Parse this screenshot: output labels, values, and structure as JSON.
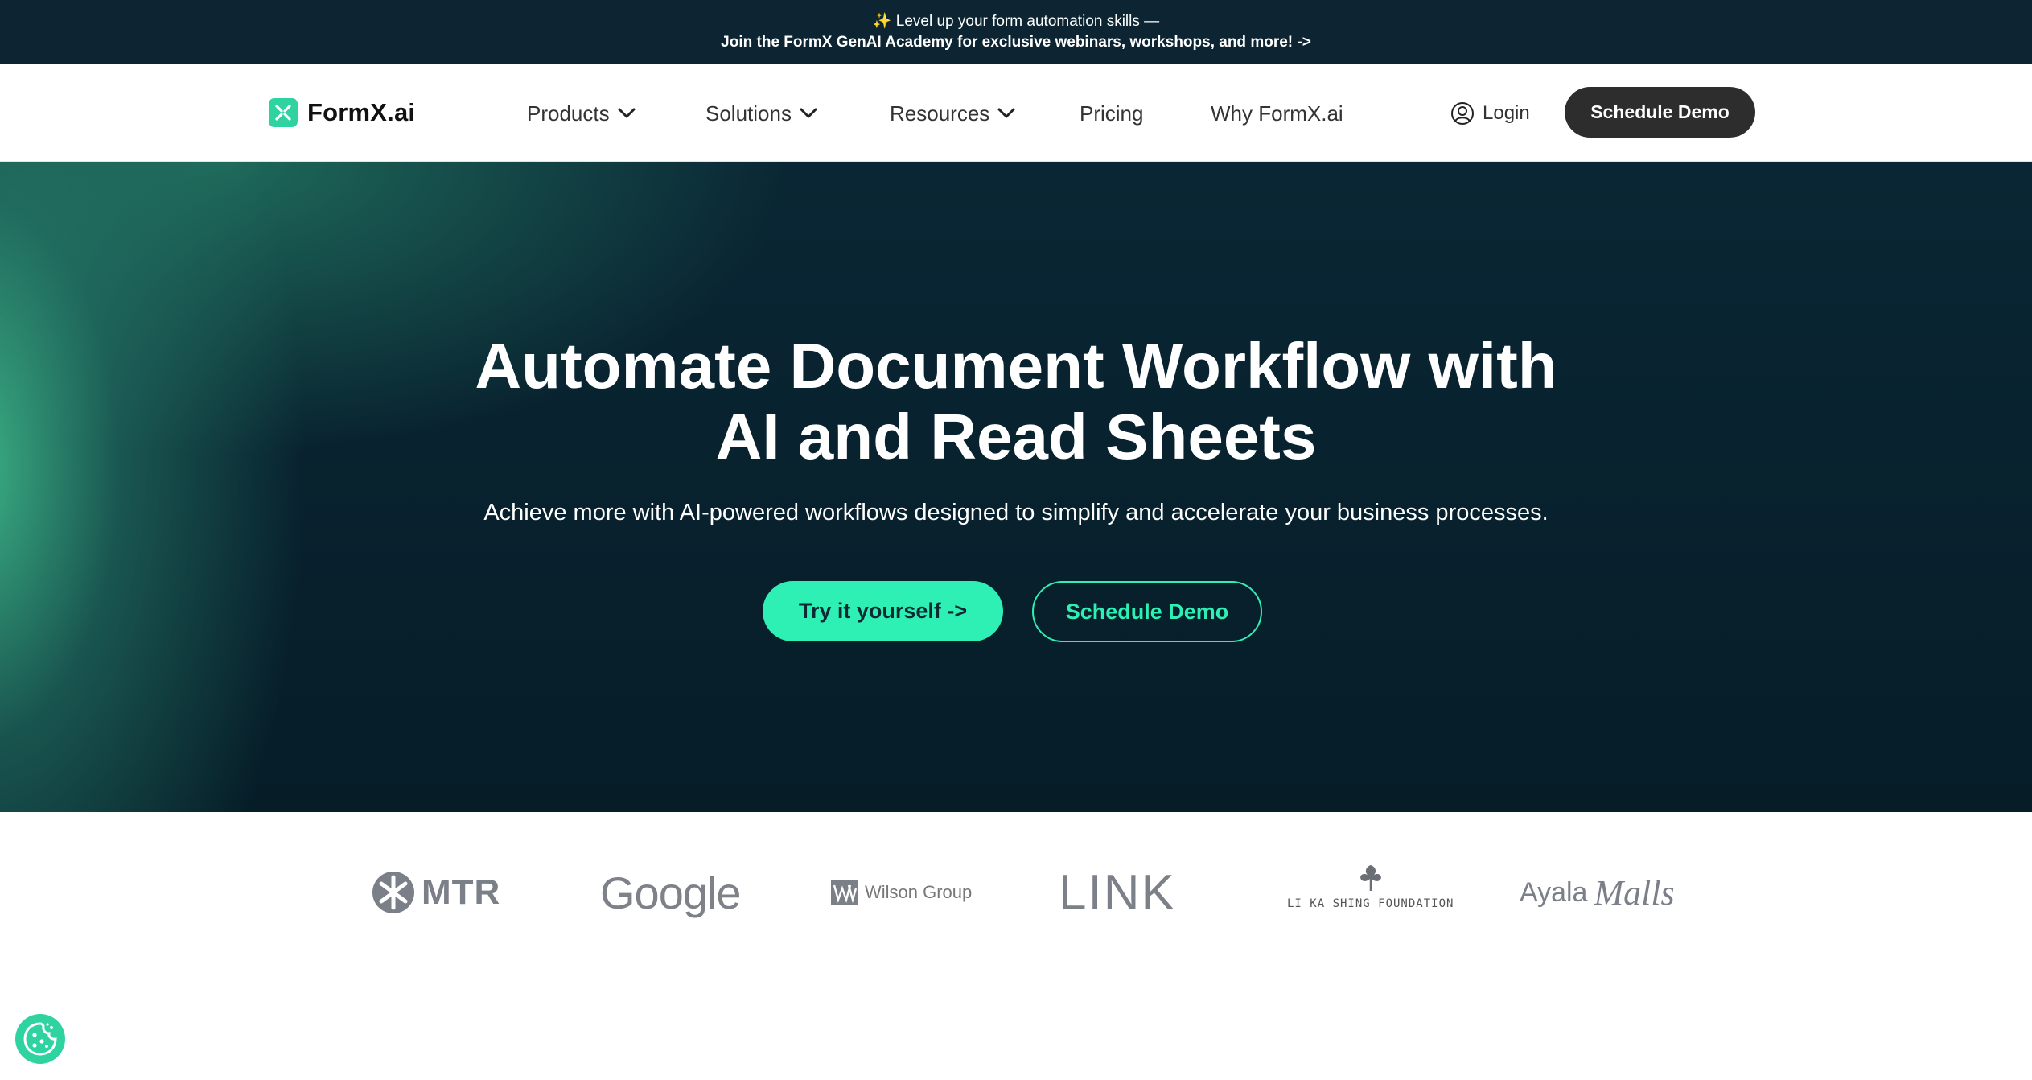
{
  "announcement": {
    "line1": "✨ Level up your form automation skills —",
    "line2": "Join the FormX GenAI Academy for exclusive webinars, workshops, and more! ->"
  },
  "nav": {
    "logo_text": "FormX.ai",
    "items": [
      {
        "label": "Products",
        "has_dropdown": true
      },
      {
        "label": "Solutions",
        "has_dropdown": true
      },
      {
        "label": "Resources",
        "has_dropdown": true
      },
      {
        "label": "Pricing",
        "has_dropdown": false
      },
      {
        "label": "Why FormX.ai",
        "has_dropdown": false
      }
    ],
    "login_label": "Login",
    "demo_label": "Schedule Demo"
  },
  "hero": {
    "title_line1": "Automate Document Workflow with",
    "title_line2": "AI and Read Sheets",
    "subtitle": "Achieve more with AI-powered workflows designed to simplify and accelerate your business processes.",
    "try_label": "Try it yourself ->",
    "demo_label": "Schedule Demo"
  },
  "clients": {
    "mtr": "MTR",
    "google": "Google",
    "wilson": "Wilson Group",
    "link": "LINK",
    "lks": "LI KA SHING FOUNDATION",
    "ayala": "Ayala",
    "malls": "Malls"
  },
  "colors": {
    "accent": "#2ef0b4",
    "brand": "#2ed3a0",
    "hero_bg": "#082230",
    "announce_bg": "#0d2532",
    "dark_button": "#2d2d2d"
  },
  "icons": {
    "logo": "formx-logo-icon",
    "dropdown": "chevron-down-icon",
    "login": "user-icon",
    "cookie": "cookie-icon"
  }
}
